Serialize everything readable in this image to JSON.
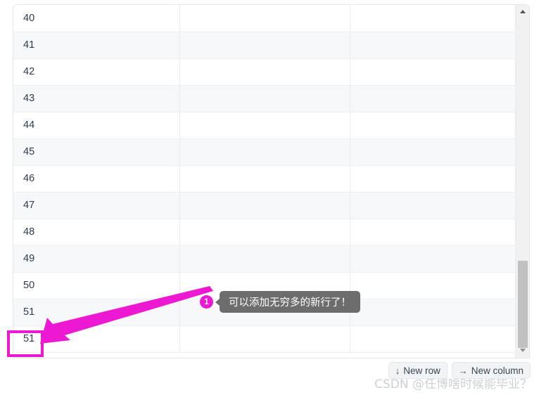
{
  "table": {
    "columns": [
      "",
      "",
      ""
    ],
    "rows": [
      {
        "id": "40",
        "cells": [
          "40",
          "",
          ""
        ]
      },
      {
        "id": "41",
        "cells": [
          "41",
          "",
          ""
        ]
      },
      {
        "id": "42",
        "cells": [
          "42",
          "",
          ""
        ]
      },
      {
        "id": "43",
        "cells": [
          "43",
          "",
          ""
        ]
      },
      {
        "id": "44",
        "cells": [
          "44",
          "",
          ""
        ]
      },
      {
        "id": "45",
        "cells": [
          "45",
          "",
          ""
        ]
      },
      {
        "id": "46",
        "cells": [
          "46",
          "",
          ""
        ]
      },
      {
        "id": "47",
        "cells": [
          "47",
          "",
          ""
        ]
      },
      {
        "id": "48",
        "cells": [
          "48",
          "",
          ""
        ]
      },
      {
        "id": "49",
        "cells": [
          "49",
          "",
          ""
        ]
      },
      {
        "id": "50",
        "cells": [
          "50",
          "",
          ""
        ]
      },
      {
        "id": "51",
        "cells": [
          "51",
          "",
          ""
        ]
      },
      {
        "id": "51b",
        "cells": [
          "51",
          "",
          ""
        ]
      }
    ]
  },
  "highlight": {
    "cell_value": "51",
    "color": "#ec18d2"
  },
  "callout": {
    "badge_number": "1",
    "text": "可以添加无穷多的新行了！",
    "badge_color": "#ec18d2",
    "bubble_color": "#6d6d6d"
  },
  "scrollbar": {
    "up_icon": "triangle-up-icon",
    "down_icon": "triangle-down-icon",
    "thumb_color": "#c1c1c1",
    "track_color": "#f1f1f1"
  },
  "actions": {
    "new_row": {
      "icon": "↓",
      "label": "New row"
    },
    "new_column": {
      "icon": "→",
      "label": "New column"
    }
  },
  "watermark": {
    "text": "CSDN @任博啥时候能毕业？"
  }
}
